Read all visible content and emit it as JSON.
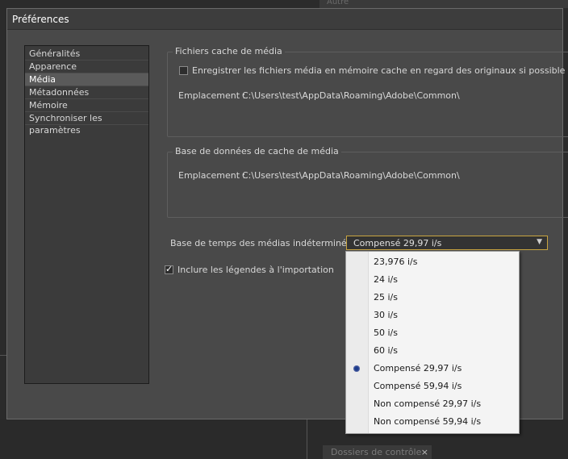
{
  "background": {
    "top_panel_text": "Autre",
    "bottom_tab_label": "Dossiers de contrôle",
    "bottom_tab_close": "×"
  },
  "dialog": {
    "title": "Préférences"
  },
  "nav": {
    "items": [
      {
        "label": "Généralités",
        "selected": false
      },
      {
        "label": "Apparence",
        "selected": false
      },
      {
        "label": "Média",
        "selected": true
      },
      {
        "label": "Métadonnées",
        "selected": false
      },
      {
        "label": "Mémoire",
        "selected": false
      },
      {
        "label": "Synchroniser les paramètres",
        "selected": false
      }
    ]
  },
  "media_cache": {
    "title": "Fichiers cache de média",
    "checkbox_label": "Enregistrer les fichiers média en mémoire cache en regard des originaux si possible",
    "checkbox_checked": false,
    "location_label": "Emplacement :",
    "location_value": "C:\\Users\\test\\AppData\\Roaming\\Adobe\\Common\\"
  },
  "cache_db": {
    "title": "Base de données de cache de média",
    "location_label": "Emplacement :",
    "location_value": "C:\\Users\\test\\AppData\\Roaming\\Adobe\\Common\\"
  },
  "timebase": {
    "label": "Base de temps des médias indéterminée :",
    "selected": "Compensé 29,97 i/s",
    "arrow": "▼",
    "options": [
      "23,976 i/s",
      "24 i/s",
      "25 i/s",
      "30 i/s",
      "50 i/s",
      "60 i/s",
      "Compensé 29,97 i/s",
      "Compensé 59,94 i/s",
      "Non compensé 29,97 i/s",
      "Non compensé 59,94 i/s"
    ],
    "selected_index": 6
  },
  "captions": {
    "checkbox_label": "Inclure les légendes à l'importation",
    "checkbox_checked": true
  },
  "colors": {
    "dialog_bg": "#494949",
    "accent_border": "#c8a440",
    "popup_bg": "#f4f4f4"
  }
}
